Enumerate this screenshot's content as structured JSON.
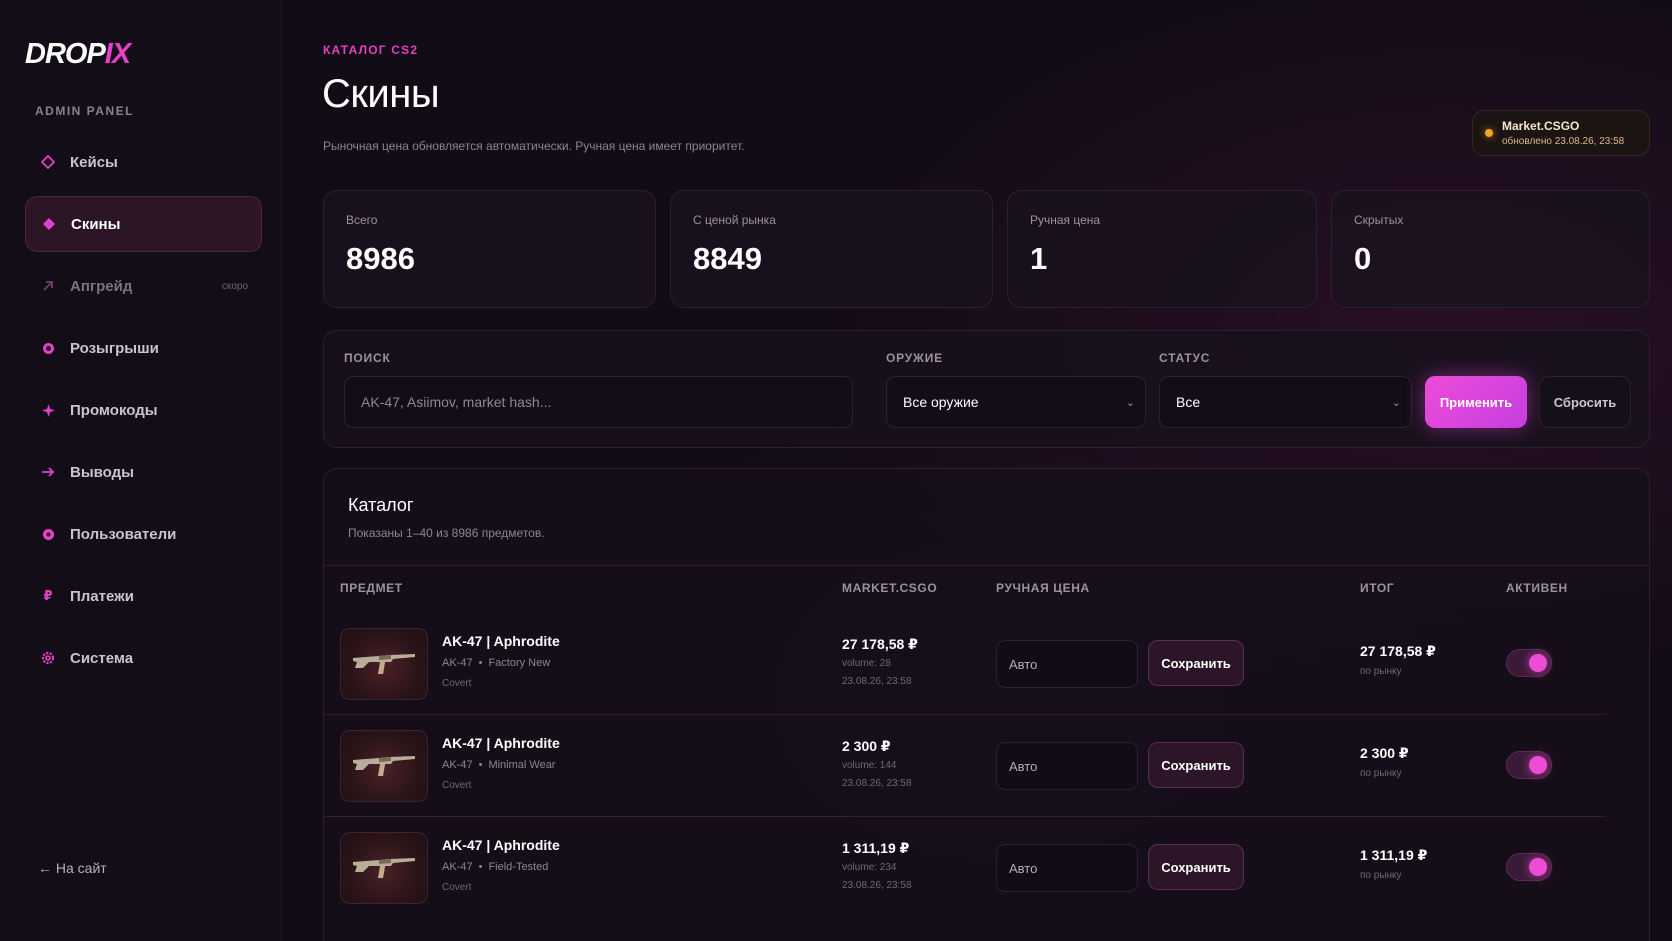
{
  "brand": {
    "logo_main": "DROP",
    "logo_accent": "IX",
    "panel_label": "ADMIN PANEL"
  },
  "nav": [
    {
      "label": "Кейсы",
      "icon": "diamond-outline-icon",
      "active": false
    },
    {
      "label": "Скины",
      "icon": "diamond-filled-icon",
      "active": true
    },
    {
      "label": "Апгрейд",
      "icon": "arrow-up-right-icon",
      "badge": "скоро",
      "dim": true
    },
    {
      "label": "Розыгрыши",
      "icon": "target-icon"
    },
    {
      "label": "Промокоды",
      "icon": "sparkle-icon"
    },
    {
      "label": "Выводы",
      "icon": "arrow-right-icon"
    },
    {
      "label": "Пользователи",
      "icon": "user-dot-icon"
    },
    {
      "label": "Платежи",
      "icon": "ruble-icon"
    },
    {
      "label": "Система",
      "icon": "gear-icon"
    }
  ],
  "back_link": "← На сайт",
  "header": {
    "eyebrow": "КАТАЛОГ CS2",
    "title": "Скины",
    "subtitle": "Рыночная цена обновляется автоматически. Ручная цена имеет приоритет."
  },
  "market_status": {
    "title": "Market.CSGO",
    "updated": "обновлено 23.08.26, 23:58",
    "dot_color": "#f5a524"
  },
  "stats": [
    {
      "label": "Всего",
      "value": "8986"
    },
    {
      "label": "С ценой рынка",
      "value": "8849"
    },
    {
      "label": "Ручная цена",
      "value": "1"
    },
    {
      "label": "Скрытых",
      "value": "0"
    }
  ],
  "filters": {
    "search_label": "ПОИСК",
    "search_placeholder": "AK-47, Asiimov, market hash...",
    "weapon_label": "ОРУЖИЕ",
    "weapon_value": "Все оружие",
    "status_label": "СТАТУС",
    "status_value": "Все",
    "apply": "Применить",
    "reset": "Сбросить"
  },
  "catalog": {
    "title": "Каталог",
    "subtitle": "Показаны 1–40 из 8986 предметов.",
    "columns": [
      "ПРЕДМЕТ",
      "MARKET.CSGO",
      "РУЧНАЯ ЦЕНА",
      "ИТОГ",
      "АКТИВЕН"
    ],
    "rows": [
      {
        "name": "AK-47 | Aphrodite",
        "weapon": "AK-47",
        "wear": "Factory New",
        "rarity": "Covert",
        "market_price": "27 178,58 ₽",
        "volume": "volume: 28",
        "date": "23.08.26, 23:58",
        "manual_placeholder": "Авто",
        "save": "Сохранить",
        "total": "27 178,58 ₽",
        "total_source": "по рынку",
        "active": true
      },
      {
        "name": "AK-47 | Aphrodite",
        "weapon": "AK-47",
        "wear": "Minimal Wear",
        "rarity": "Covert",
        "market_price": "2 300 ₽",
        "volume": "volume: 144",
        "date": "23.08.26, 23:58",
        "manual_placeholder": "Авто",
        "save": "Сохранить",
        "total": "2 300 ₽",
        "total_source": "по рынку",
        "active": true
      },
      {
        "name": "AK-47 | Aphrodite",
        "weapon": "AK-47",
        "wear": "Field-Tested",
        "rarity": "Covert",
        "market_price": "1 311,19 ₽",
        "volume": "volume: 234",
        "date": "23.08.26, 23:58",
        "manual_placeholder": "Авто",
        "save": "Сохранить",
        "total": "1 311,19 ₽",
        "total_source": "по рынку",
        "active": true
      }
    ]
  },
  "colors": {
    "accent": "#e640c8",
    "background": "#120c16",
    "status": "#f5a524"
  }
}
